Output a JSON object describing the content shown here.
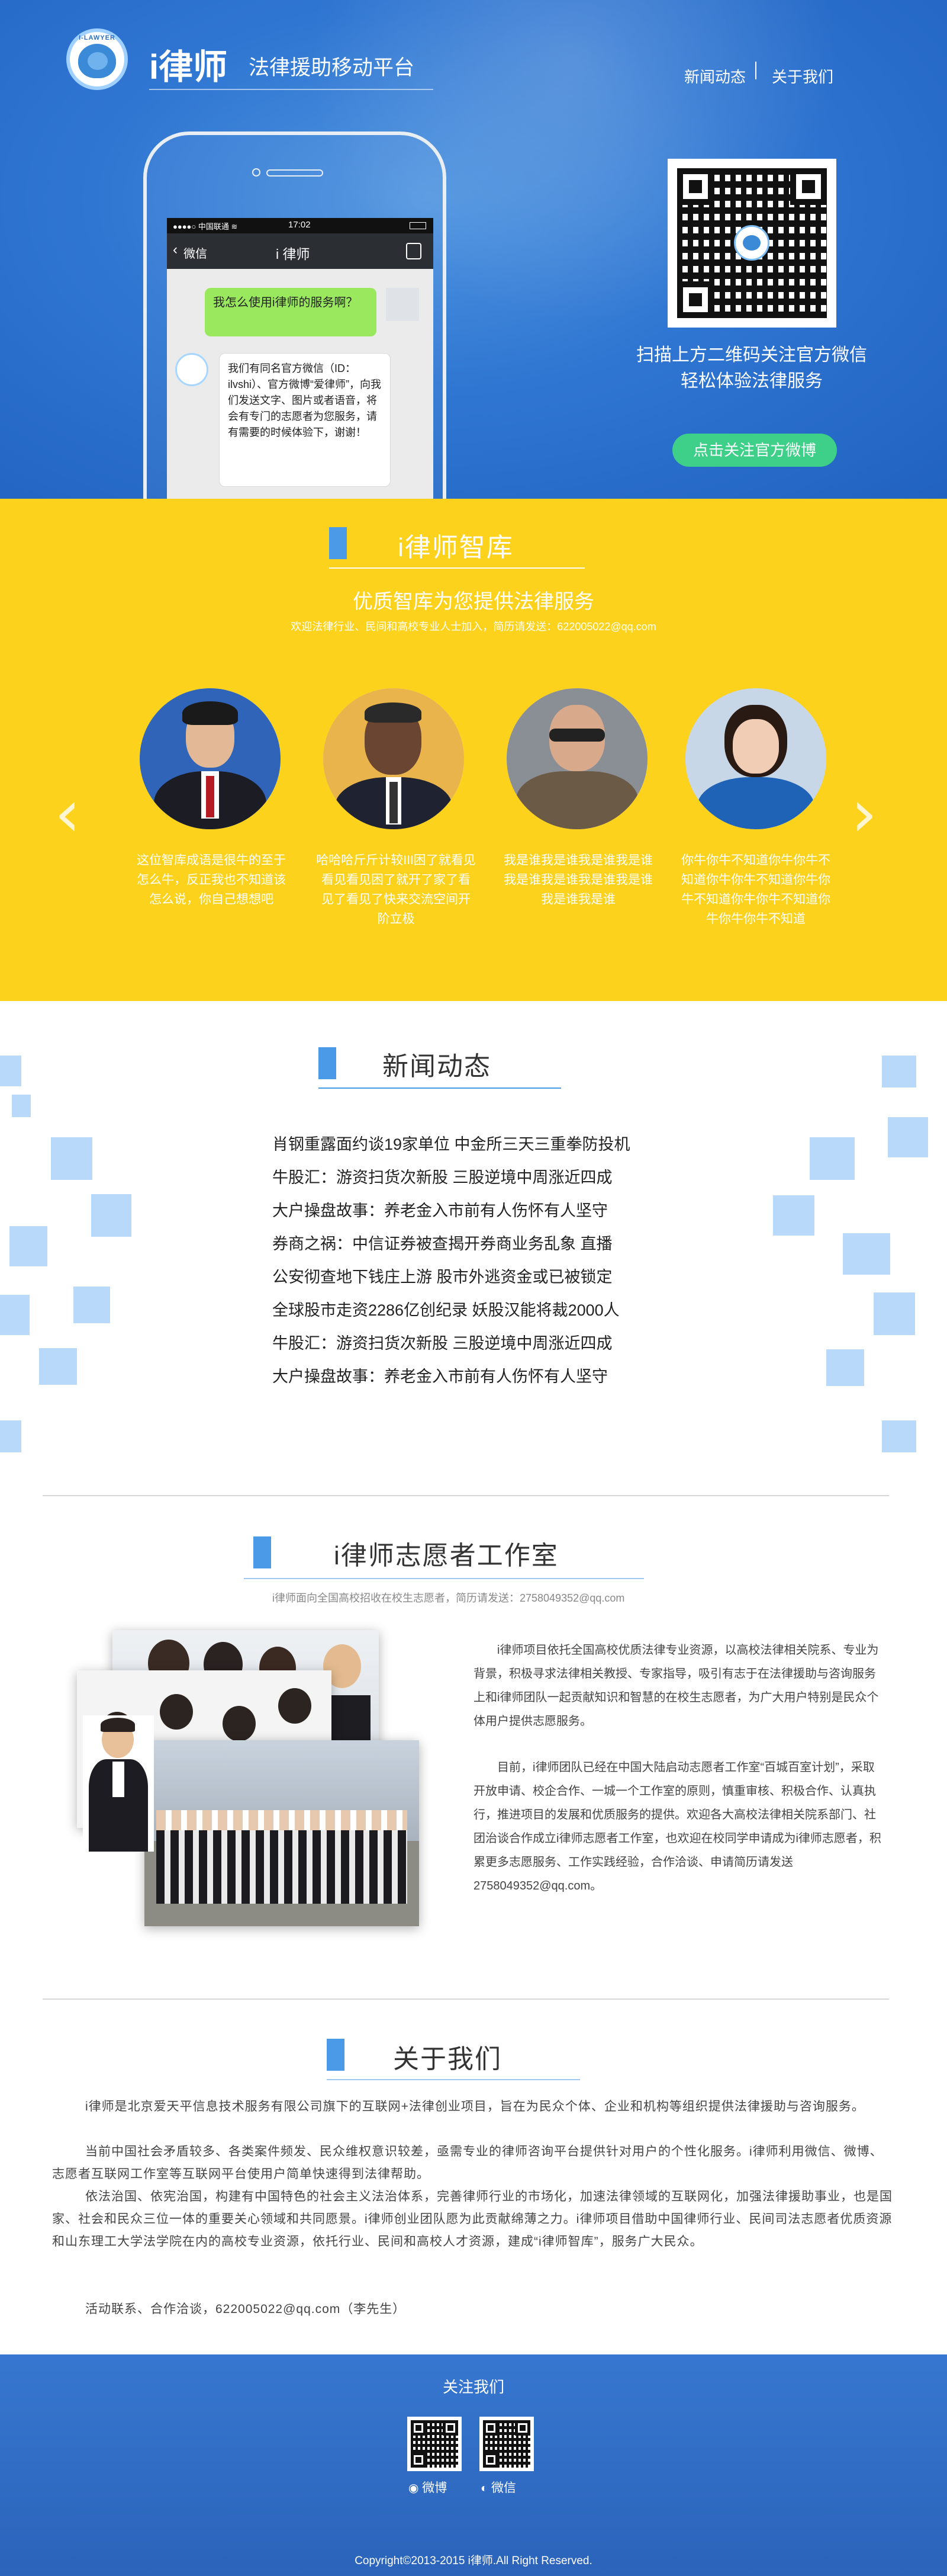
{
  "header": {
    "brand_name": "i律师",
    "brand_subtitle": "法律援助移动平台",
    "logo_text": "I-LAWYER",
    "nav": [
      "新闻动态",
      "关于我们"
    ]
  },
  "phone": {
    "carrier": "●●●●○ 中国联通 ≋",
    "time": "17:02",
    "back_label": "微信",
    "chat_title": "i 律师",
    "user_message": "我怎么使用i律师的服务啊？",
    "bot_message": "我们有同名官方微信（ID：ilvshi）、官方微博“爱律师”，向我们发送文字、图片或者语音，将会有专门的志愿者为您服务，请有需要的时候体验下，谢谢！"
  },
  "qr_section": {
    "line1": "扫描上方二维码关注官方微信",
    "line2": "轻松体验法律服务",
    "button": "点击关注官方微博"
  },
  "think_tank": {
    "title": "i律师智库",
    "subtitle": "优质智库为您提供法律服务",
    "note": "欢迎法律行业、民间和高校专业人士加入，简历请发送：622005022@qq.com",
    "prev_arrow": "‹",
    "next_arrow": "›",
    "people": [
      {
        "caption": "这位智库成语是很牛的至于怎么牛，反正我也不知道该怎么说，你自己想想吧"
      },
      {
        "caption": "哈哈哈斤斤计较III困了就看见看见看见困了就开了家了看见了看见了快来交流空间开阶立极"
      },
      {
        "caption": "我是谁我是谁我是谁我是谁我是谁我是谁我是谁我是谁我是谁我是谁"
      },
      {
        "caption": "你牛你牛不知道你牛你牛不知道你牛你牛不知道你牛你牛不知道你牛你牛不知道你牛你牛你牛不知道"
      }
    ]
  },
  "news": {
    "title": "新闻动态",
    "items": [
      "肖钢重露面约谈19家单位 中金所三天三重拳防投机",
      "牛股汇：游资扫货次新股 三股逆境中周涨近四成",
      "大户操盘故事：养老金入市前有人伤怀有人坚守",
      "券商之祸：中信证券被查揭开券商业务乱象 直播",
      "公安彻查地下钱庄上游 股市外逃资金或已被锁定",
      "全球股市走资2286亿创纪录 妖股汉能将裁2000人",
      "牛股汇：游资扫货次新股 三股逆境中周涨近四成",
      "大户操盘故事：养老金入市前有人伤怀有人坚守"
    ]
  },
  "volunteer": {
    "title": "i律师志愿者工作室",
    "note": "i律师面向全国高校招收在校生志愿者，简历请发送：2758049352@qq.com",
    "para1": "i律师项目依托全国高校优质法律专业资源，以高校法律相关院系、专业为背景，积极寻求法律相关教授、专家指导，吸引有志于在法律援助与咨询服务上和i律师团队一起贡献知识和智慧的在校生志愿者，为广大用户特别是民众个体用户提供志愿服务。",
    "para2": "目前，i律师团队已经在中国大陆启动志愿者工作室“百城百室计划”，采取开放申请、校企合作、一城一个工作室的原则，慎重审核、积极合作、认真执行，推进项目的发展和优质服务的提供。欢迎各大高校法律相关院系部门、社团治谈合作成立i律师志愿者工作室，也欢迎在校同学申请成为i律师志愿者，积累更多志愿服务、工作实践经验，合作洽谈、申请简历请发送2758049352@qq.com。"
  },
  "about": {
    "title": "关于我们",
    "paragraphs": [
      "i律师是北京爱天平信息技术服务有限公司旗下的互联网+法律创业项目，旨在为民众个体、企业和机构等组织提供法律援助与咨询服务。",
      "当前中国社会矛盾较多、各类案件频发、民众维权意识较差，亟需专业的律师咨询平台提供针对用户的个性化服务。i律师利用微信、微博、志愿者互联网工作室等互联网平台使用户简单快速得到法律帮助。",
      "依法治国、依宪治国，构建有中国特色的社会主义法治体系，完善律师行业的市场化，加速法律领域的互联网化，加强法律援助事业，也是国家、社会和民众三位一体的重要关心领域和共同愿景。i律师创业团队愿为此贡献绵薄之力。i律师项目借助中国律师行业、民间司法志愿者优质资源和山东理工大学法学院在内的高校专业资源，依托行业、民间和高校人才资源，建成“i律师智库”，服务广大民众。",
      "活动联系、合作洽谈，622005022@qq.com（李先生）"
    ]
  },
  "footer": {
    "follow": "关注我们",
    "weibo": "微博",
    "wechat": "微信",
    "copyright": "Copyright©2013-2015 i律师.All Right Reserved."
  },
  "colors": {
    "hero_blue": "#2f76d2",
    "yellow": "#fcd21c",
    "accent_blue": "#4a9ae8",
    "green": "#3ecf88"
  }
}
